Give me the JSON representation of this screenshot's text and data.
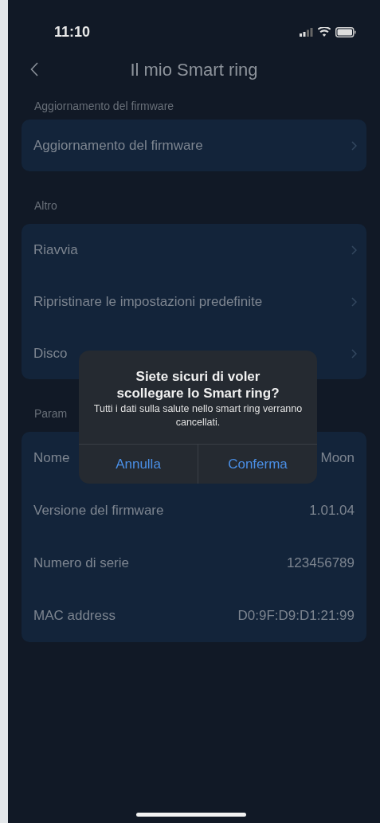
{
  "status_bar": {
    "time": "11:10"
  },
  "header": {
    "title": "Il mio Smart ring"
  },
  "sections": [
    {
      "label": "Aggiornamento del firmware",
      "rows": [
        {
          "kind": "link",
          "label": "Aggiornamento del firmware"
        }
      ]
    },
    {
      "label": "Altro",
      "rows": [
        {
          "kind": "link",
          "label": "Riavvia"
        },
        {
          "kind": "link",
          "label": "Ripristinare le impostazioni predefinite"
        },
        {
          "kind": "link",
          "label": "Disco"
        }
      ]
    },
    {
      "label": "Param",
      "rows": [
        {
          "kind": "info",
          "label": "Nome",
          "value": "Moon"
        },
        {
          "kind": "info",
          "label": "Versione del firmware",
          "value": "1.01.04"
        },
        {
          "kind": "info",
          "label": "Numero di serie",
          "value": "123456789"
        },
        {
          "kind": "info",
          "label": "MAC address",
          "value": "D0:9F:D9:D1:21:99"
        }
      ]
    }
  ],
  "dialog": {
    "title": "Siete sicuri di voler scollegare lo Smart ring?",
    "message": "Tutti i dati sulla salute nello smart ring verranno cancellati.",
    "buttons": [
      "Annulla",
      "Conferma"
    ]
  }
}
